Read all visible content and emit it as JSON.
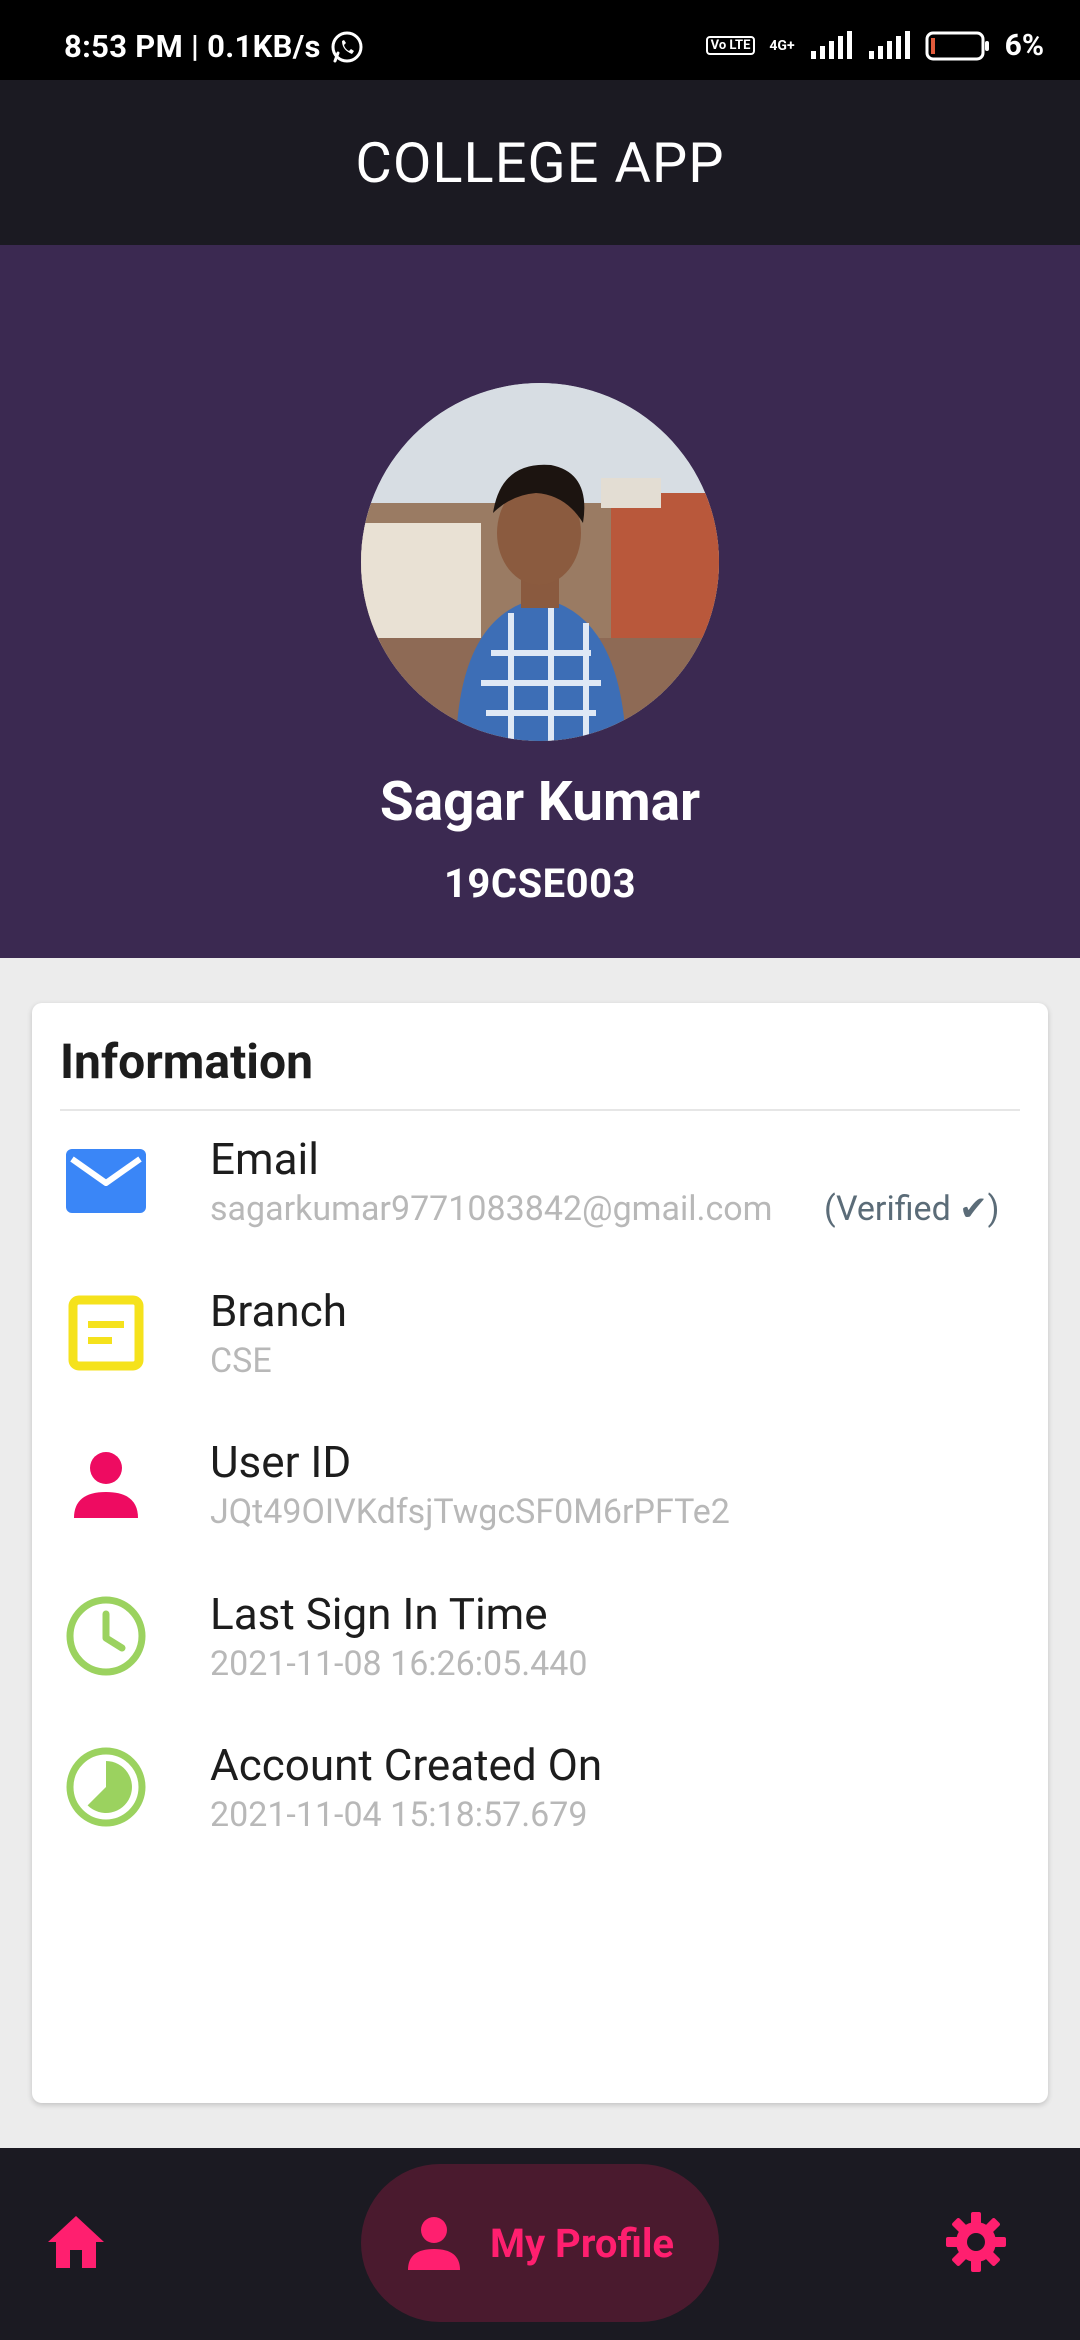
{
  "status_bar": {
    "time_speed": "8:53 PM | 0.1KB/s",
    "volte": "Vo LTE",
    "network": "4G+",
    "battery": "6%"
  },
  "app_bar": {
    "title": "COLLEGE APP"
  },
  "profile": {
    "name": "Sagar Kumar",
    "id": "19CSE003"
  },
  "info": {
    "title": "Information",
    "email": {
      "label": "Email",
      "value": "sagarkumar9771083842@gmail.com",
      "badge": "(Verified ✔)"
    },
    "branch": {
      "label": "Branch",
      "value": "CSE"
    },
    "user_id": {
      "label": "User ID",
      "value": "JQt49OIVKdfsjTwgcSF0M6rPFTe2"
    },
    "last_sign_in": {
      "label": "Last Sign In Time",
      "value": "2021-11-08 16:26:05.440"
    },
    "created_on": {
      "label": "Account Created On",
      "value": "2021-11-04 15:18:57.679"
    }
  },
  "bottom_nav": {
    "profile_label": "My Profile",
    "icons": [
      "home-icon",
      "person-icon",
      "gear-icon"
    ]
  },
  "colors": {
    "header_purple": "#3b2951",
    "app_bar": "#1b1a22",
    "accent_pink": "#ff1f6f",
    "email_blue": "#3a86f7",
    "branch_yellow": "#f5e21c",
    "user_pink": "#ee0b61",
    "clock_green": "#9bd25f"
  }
}
